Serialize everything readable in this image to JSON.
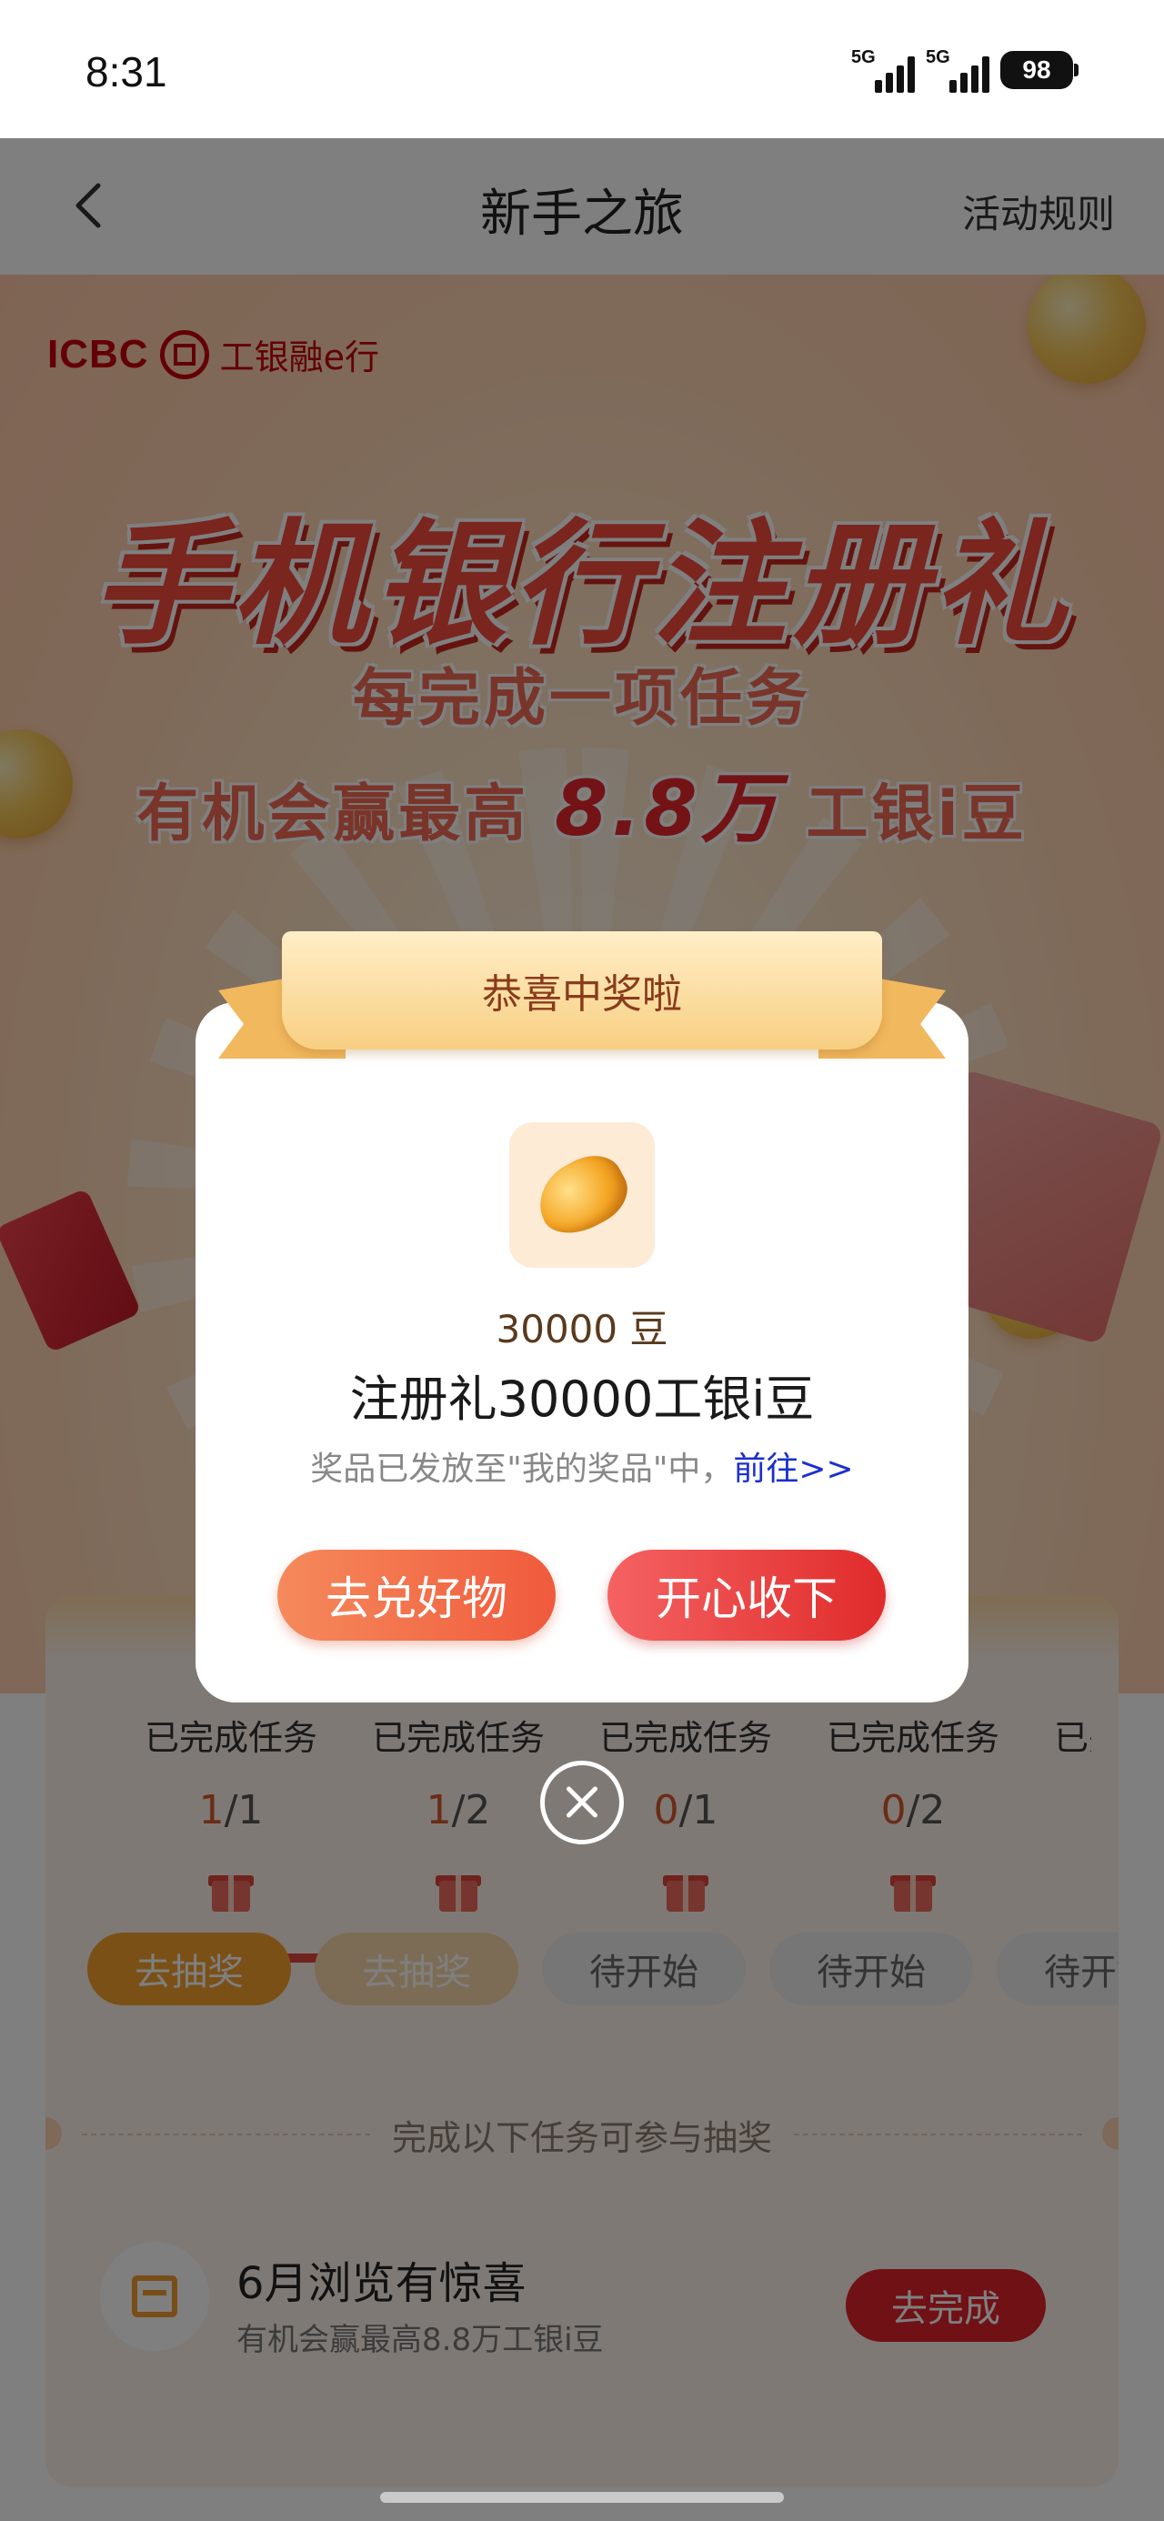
{
  "status_bar": {
    "time": "8:31",
    "net1": "5G",
    "net2": "5G",
    "battery": "98"
  },
  "nav": {
    "title": "新手之旅",
    "rules": "活动规则"
  },
  "hero": {
    "logo_en": "ICBC",
    "logo_cn": "工银融e行",
    "title": "手机银行注册礼",
    "sub1": "每完成一项任务",
    "sub2_prefix": "有机会赢最高",
    "sub2_highlight": "8.8万",
    "sub2_suffix": "工银i豆"
  },
  "tasks": [
    {
      "label": "已完成任务",
      "done": "1",
      "total": "/1",
      "button": "去抽奖"
    },
    {
      "label": "已完成任务",
      "done": "1",
      "total": "/2",
      "button": "去抽奖"
    },
    {
      "label": "已完成任务",
      "done": "0",
      "total": "/1",
      "button": "待开始"
    },
    {
      "label": "已完成任务",
      "done": "0",
      "total": "/2",
      "button": "待开始"
    },
    {
      "label": "已完成任务",
      "done": "0",
      "total": "",
      "button": "待开始"
    }
  ],
  "divider_text": "完成以下任务可参与抽奖",
  "task_item": {
    "title": "6月浏览有惊喜",
    "subtitle": "有机会赢最高8.8万工银i豆",
    "button": "去完成"
  },
  "modal": {
    "ribbon": "恭喜中奖啦",
    "prize_amount": "30000 豆",
    "prize_name": "注册礼30000工银i豆",
    "note": "奖品已发放至\"我的奖品\"中，",
    "note_link": "前往>>",
    "btn_redeem": "去兑好物",
    "btn_accept": "开心收下"
  }
}
